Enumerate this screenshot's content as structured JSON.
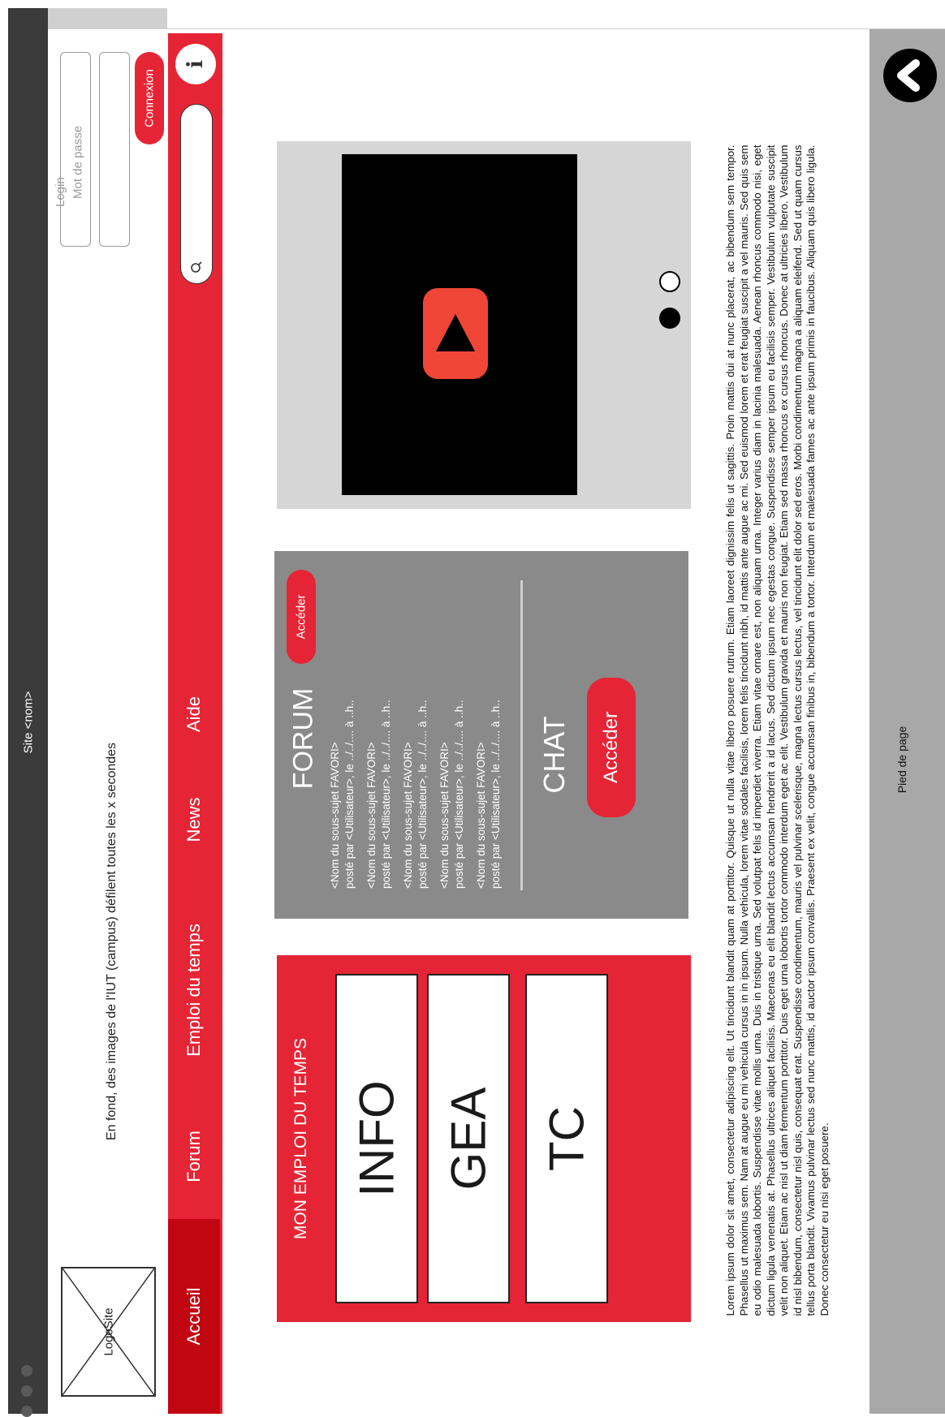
{
  "window": {
    "title": "Site <nom>"
  },
  "header": {
    "logo_label": "LogoSite",
    "background_note": "En fond, des images de l'IUT (campus) défilent toutes les x secondes",
    "login_placeholder": "Login",
    "password_placeholder": "Mot de passe",
    "login_button": "Connexion"
  },
  "nav": {
    "items": [
      {
        "label": "Accueil",
        "active": true
      },
      {
        "label": "Forum"
      },
      {
        "label": "Emploi du temps"
      },
      {
        "label": "News"
      },
      {
        "label": "Aide"
      }
    ],
    "search_icon": "search-icon",
    "info_icon": "info-icon"
  },
  "schedule": {
    "title": "MON EMPLOI DU TEMPS",
    "items": [
      "INFO",
      "GEA",
      "TC"
    ]
  },
  "forum": {
    "title": "FORUM",
    "access_button": "Accéder",
    "posts": [
      {
        "topic": "<Nom du sous-sujet FAVORI>",
        "meta": "posté par <Utilisateur>, le ../../.... à ..h.."
      },
      {
        "topic": "<Nom du sous-sujet FAVORI>",
        "meta": "posté par <Utilisateur>, le ../../.... à ..h.."
      },
      {
        "topic": "<Nom du sous-sujet FAVORI>",
        "meta": "posté par <Utilisateur>, le ../../.... à ..h.."
      },
      {
        "topic": "<Nom du sous-sujet FAVORI>",
        "meta": "posté par <Utilisateur>, le ../../.... à ..h.."
      },
      {
        "topic": "<Nom du sous-sujet FAVORI>",
        "meta": "posté par <Utilisateur>, le ../../.... à ..h.."
      }
    ]
  },
  "chat": {
    "title": "CHAT",
    "access_button": "Accéder"
  },
  "video": {
    "play_icon": "play-icon",
    "carousel": {
      "count": 2,
      "active": 0
    }
  },
  "article": {
    "text": "Lorem ipsum dolor sit amet, consectetur adipiscing elit. Ut tincidunt blandit quam at porttitor. Quisque ut nulla vitae libero posuere rutrum. Etiam laoreet dignissim felis ut sagittis. Proin mattis dui at nunc placerat, ac bibendum sem tempor. Phasellus ut maximus sem. Nam at augue eu mi vehicula cursus in in ipsum. Nulla vehicula, lorem vitae sodales facilisis, lorem felis tincidunt nibh, id mattis ante augue ac mi. Sed euismod lorem et erat feugiat suscipit a vel mauris. Sed quis sem eu odio malesuada lobortis. Suspendisse vitae mollis urna. Duis in tristique urna. Sed volutpat felis id imperdiet viverra. Etiam vitae ornare est, non aliquam urna. Integer varius diam in lacinia malesuada. Aenean rhoncus commodo nisi, eget dictum ligula venenatis at. Phasellus ultrices aliquet facilisis. Maecenas eu elit blandit lectus accumsan hendrerit a id lacus. Sed dictum ipsum nec egestas congue. Suspendisse semper ipsum eu facilisis semper. Vestibulum vulputate suscipit velit non aliquet. Etiam ac nisl ut diam fermentum porttitor. Duis eget urna lobortis tortor commodo interdum eget ac elit. Vestibulum gravida et mauris non feugiat. Etiam sed massa rhoncus ex cursus rhoncus. Donec at ultricies libero. Vestibulum id nisl bibendum, consectetur nisl quis, consequat erat. Suspendisse condimentum, mauris vel pulvinar scelerisque, magna lectus cursus lectus, vel tincidunt elit dolor sed eros. Morbi condimentum magna a aliquam eleifend. Sed ut quam cursus tellus porta blandit. Vivamus pulvinar lectus sed nunc mattis, id auctor ipsum convallis. Praesent ex velit, congue accumsan finibus in, bibendum a tortor. Interdum et malesuada fames ac ante ipsum primis in faucibus. Aliquam quis libero ligula. Donec consectetur eu nisi eget posuere."
  },
  "footer": {
    "label": "Pied de page",
    "back_icon": "chevron-left-icon"
  },
  "colors": {
    "accent": "#e52535",
    "accent_dark": "#c20611",
    "panel_gray": "#8a8a8a",
    "footer_gray": "#a8a8a8"
  }
}
